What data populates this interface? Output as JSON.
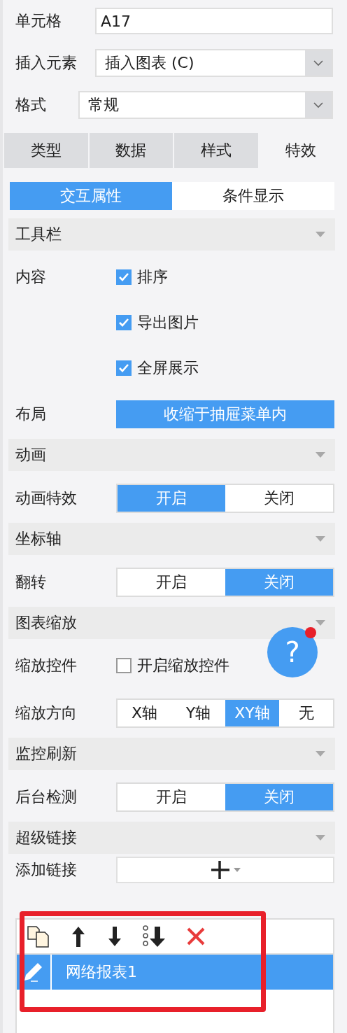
{
  "fields": [
    {
      "label": "单元格",
      "kind": "text",
      "value": "A17"
    },
    {
      "label": "插入元素",
      "kind": "select",
      "value": "插入图表 (C)"
    },
    {
      "label": "格式",
      "kind": "select",
      "value": "常规"
    }
  ],
  "tabs": [
    {
      "label": "类型",
      "selected": false
    },
    {
      "label": "数据",
      "selected": false
    },
    {
      "label": "样式",
      "selected": false
    },
    {
      "label": "特效",
      "selected": true
    }
  ],
  "subtabs": [
    {
      "label": "交互属性",
      "selected": true
    },
    {
      "label": "条件显示",
      "selected": false
    }
  ],
  "sections": [
    {
      "title": "工具栏",
      "rows": [
        {
          "label": "内容",
          "kind": "checks",
          "options": [
            {
              "label": "排序",
              "checked": true
            },
            {
              "label": "导出图片",
              "checked": true
            },
            {
              "label": "全屏展示",
              "checked": true
            }
          ]
        },
        {
          "label": "布局",
          "kind": "button",
          "text": "收缩于抽屉菜单内"
        }
      ]
    },
    {
      "title": "动画",
      "rows": [
        {
          "label": "动画特效",
          "kind": "segmented",
          "options": [
            {
              "label": "开启",
              "selected": true
            },
            {
              "label": "关闭",
              "selected": false
            }
          ]
        }
      ]
    },
    {
      "title": "坐标轴",
      "rows": [
        {
          "label": "翻转",
          "kind": "segmented",
          "options": [
            {
              "label": "开启",
              "selected": false
            },
            {
              "label": "关闭",
              "selected": true
            }
          ]
        }
      ]
    },
    {
      "title": "图表缩放",
      "rows": [
        {
          "label": "缩放控件",
          "kind": "checks",
          "options": [
            {
              "label": "开启缩放控件",
              "checked": false
            }
          ]
        },
        {
          "label": "缩放方向",
          "kind": "segmented",
          "options": [
            {
              "label": "X轴",
              "selected": false
            },
            {
              "label": "Y轴",
              "selected": false
            },
            {
              "label": "XY轴",
              "selected": true
            },
            {
              "label": "无",
              "selected": false
            }
          ]
        }
      ]
    },
    {
      "title": "监控刷新",
      "rows": [
        {
          "label": "后台检测",
          "kind": "segmented",
          "options": [
            {
              "label": "开启",
              "selected": false
            },
            {
              "label": "关闭",
              "selected": true
            }
          ]
        }
      ]
    },
    {
      "title": "超级链接",
      "rows": [
        {
          "label": "添加链接",
          "kind": "add"
        }
      ]
    }
  ],
  "link_list": {
    "rows": [
      {
        "label": "网络报表1",
        "selected": true
      }
    ]
  },
  "help_button": {
    "label": "?",
    "notification": true
  },
  "highlight_frame": true
}
